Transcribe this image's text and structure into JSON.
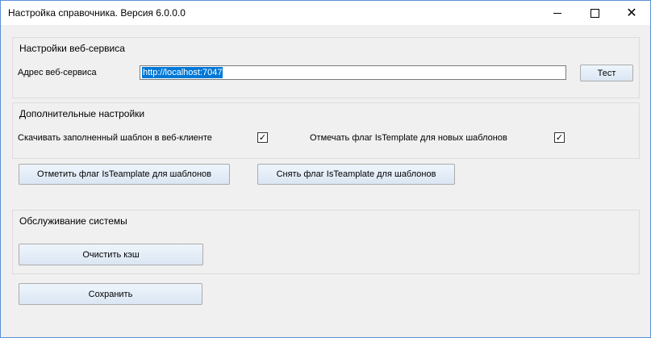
{
  "window": {
    "title": "Настройка справочника. Версия  6.0.0.0",
    "minimize_icon": "minimize-icon",
    "maximize_icon": "maximize-icon",
    "close_icon": "close-icon",
    "close_glyph": "✕"
  },
  "webservice": {
    "group_title": "Настройки веб-сервиса",
    "address_label": "Адрес веб-сервиса",
    "address_value": "http://localhost:7047",
    "test_button": "Тест"
  },
  "additional": {
    "group_title": "Дополнительные настройки",
    "download_filled_label": "Скачивать заполненный шаблон в веб-клиенте",
    "download_filled_checked": true,
    "mark_istemplate_label": "Отмечать флаг IsTemplate для новых шаблонов",
    "mark_istemplate_checked": true,
    "check_glyph": "✓",
    "set_flag_button": "Отметить флаг IsTeamplate для шаблонов",
    "remove_flag_button": "Снять флаг IsTeamplate для шаблонов"
  },
  "maintenance": {
    "group_title": "Обслуживание системы",
    "clear_cache_button": "Очистить кэш"
  },
  "footer": {
    "save_button": "Сохранить"
  }
}
